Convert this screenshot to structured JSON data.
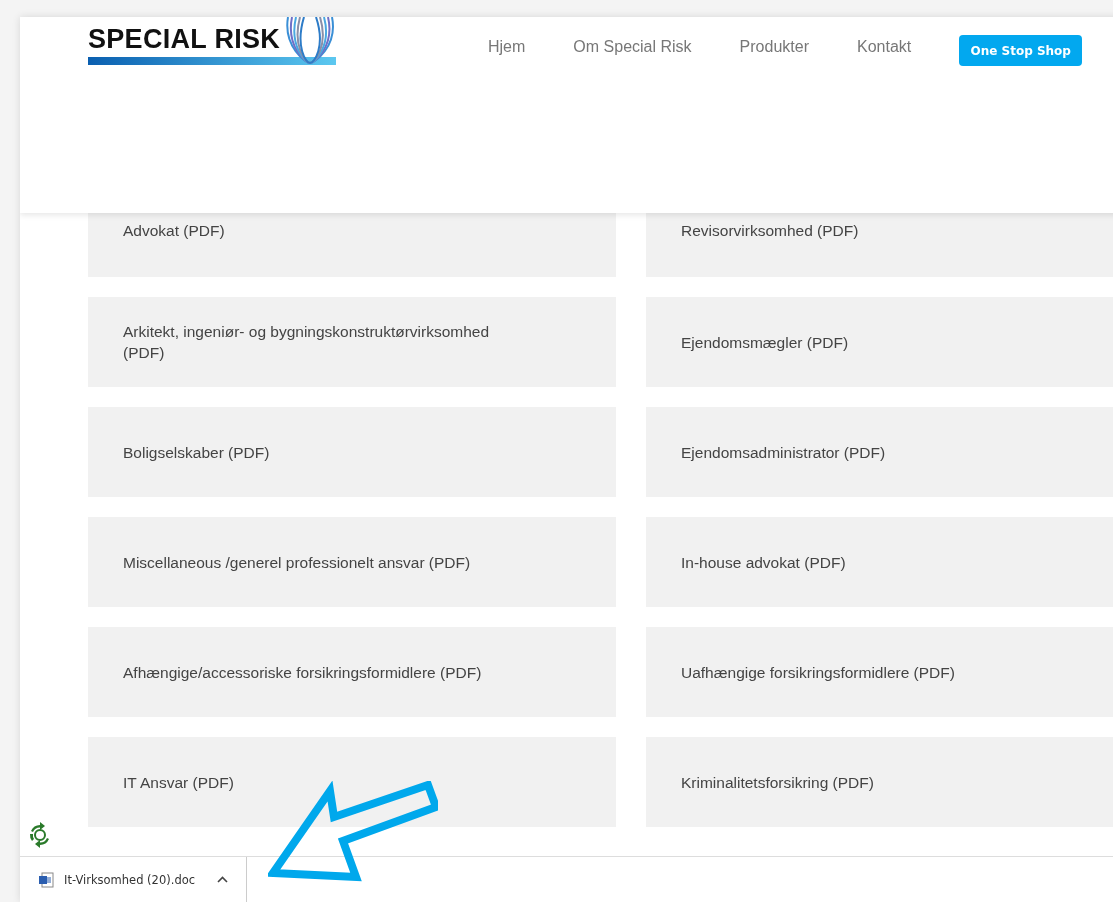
{
  "header": {
    "logo": "SPECIAL RISK",
    "nav": [
      "Hjem",
      "Om Special Risk",
      "Produkter",
      "Kontakt"
    ],
    "cta": "One Stop Shop"
  },
  "documents": [
    {
      "label": "Advokat (PDF)"
    },
    {
      "label": "Revisorvirksomhed (PDF)"
    },
    {
      "label": "Arkitekt, ingeniør- og bygningskonstruktørvirksomhed (PDF)"
    },
    {
      "label": "Ejendomsmægler (PDF)"
    },
    {
      "label": "Boligselskaber (PDF)"
    },
    {
      "label": "Ejendomsadministrator (PDF)"
    },
    {
      "label": "Miscellaneous /generel professionelt ansvar (PDF)"
    },
    {
      "label": "In-house advokat (PDF)"
    },
    {
      "label": "Afhængige/accessoriske forsikringsformidlere (PDF)"
    },
    {
      "label": "Uafhængige forsikringsformidlere (PDF)"
    },
    {
      "label": "IT Ansvar (PDF)"
    },
    {
      "label": "Kriminalitetsforsikring (PDF)"
    }
  ],
  "download_bar": {
    "file": "It-Virksomhed (20).doc"
  }
}
